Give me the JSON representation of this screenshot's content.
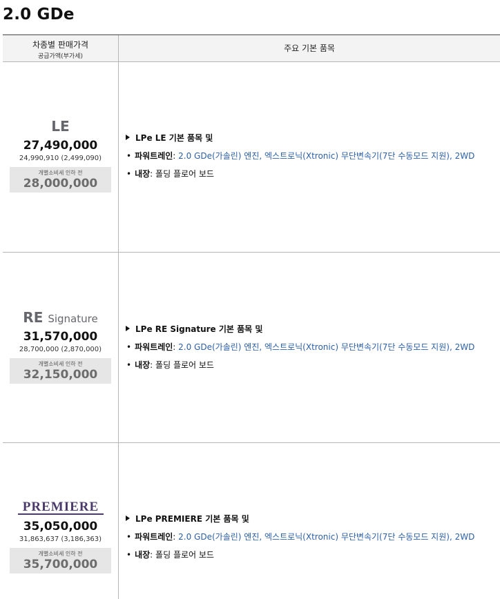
{
  "page": {
    "title": "2.0 GDe"
  },
  "table": {
    "header_left_main": "차종별 판매가격",
    "header_left_sub": "공급가액(부가세)",
    "header_right": "주요 기본 품목"
  },
  "trims": [
    {
      "name": "LE",
      "price": "27,490,000",
      "supply": "24,990,910 (2,499,090)",
      "pre_tax_label": "개별소비세 인하 전",
      "pre_tax_price": "28,000,000",
      "package": "LPe LE 기본 품목 및",
      "powertrain_label": "파워트레인",
      "powertrain_value": "2.0 GDe(가솔린) 엔진, 엑스트로닉(Xtronic) 무단변속기(7단 수동모드 지원), 2WD",
      "interior_label": "내장",
      "interior_value": "폴딩 플로어 보드"
    },
    {
      "name": "RE",
      "name_suffix": "Signature",
      "price": "31,570,000",
      "supply": "28,700,000 (2,870,000)",
      "pre_tax_label": "개별소비세 인하 전",
      "pre_tax_price": "32,150,000",
      "package": "LPe RE Signature 기본 품목 및",
      "powertrain_label": "파워트레인",
      "powertrain_value": "2.0 GDe(가솔린) 엔진, 엑스트로닉(Xtronic) 무단변속기(7단 수동모드 지원), 2WD",
      "interior_label": "내장",
      "interior_value": "폴딩 플로어 보드"
    },
    {
      "logo_text": "PREMIERE",
      "logo_color": "#4a3a6b",
      "price": "35,050,000",
      "supply": "31,863,637 (3,186,363)",
      "pre_tax_label": "개별소비세 인하 전",
      "pre_tax_price": "35,700,000",
      "package": "LPe PREMIERE 기본 품목 및",
      "powertrain_label": "파워트레인",
      "powertrain_value": "2.0 GDe(가솔린) 엔진, 엑스트로닉(Xtronic) 무단변속기(7단 수동모드 지원), 2WD",
      "interior_label": "내장",
      "interior_value": "폴딩 플로어 보드"
    }
  ],
  "symbols": {
    "bullet": "•",
    "separator": ":"
  },
  "colors": {
    "accent_blue": "#2b5fa8",
    "trim_gray": "#66676d",
    "pre_tax_bg": "#e6e6e6"
  }
}
